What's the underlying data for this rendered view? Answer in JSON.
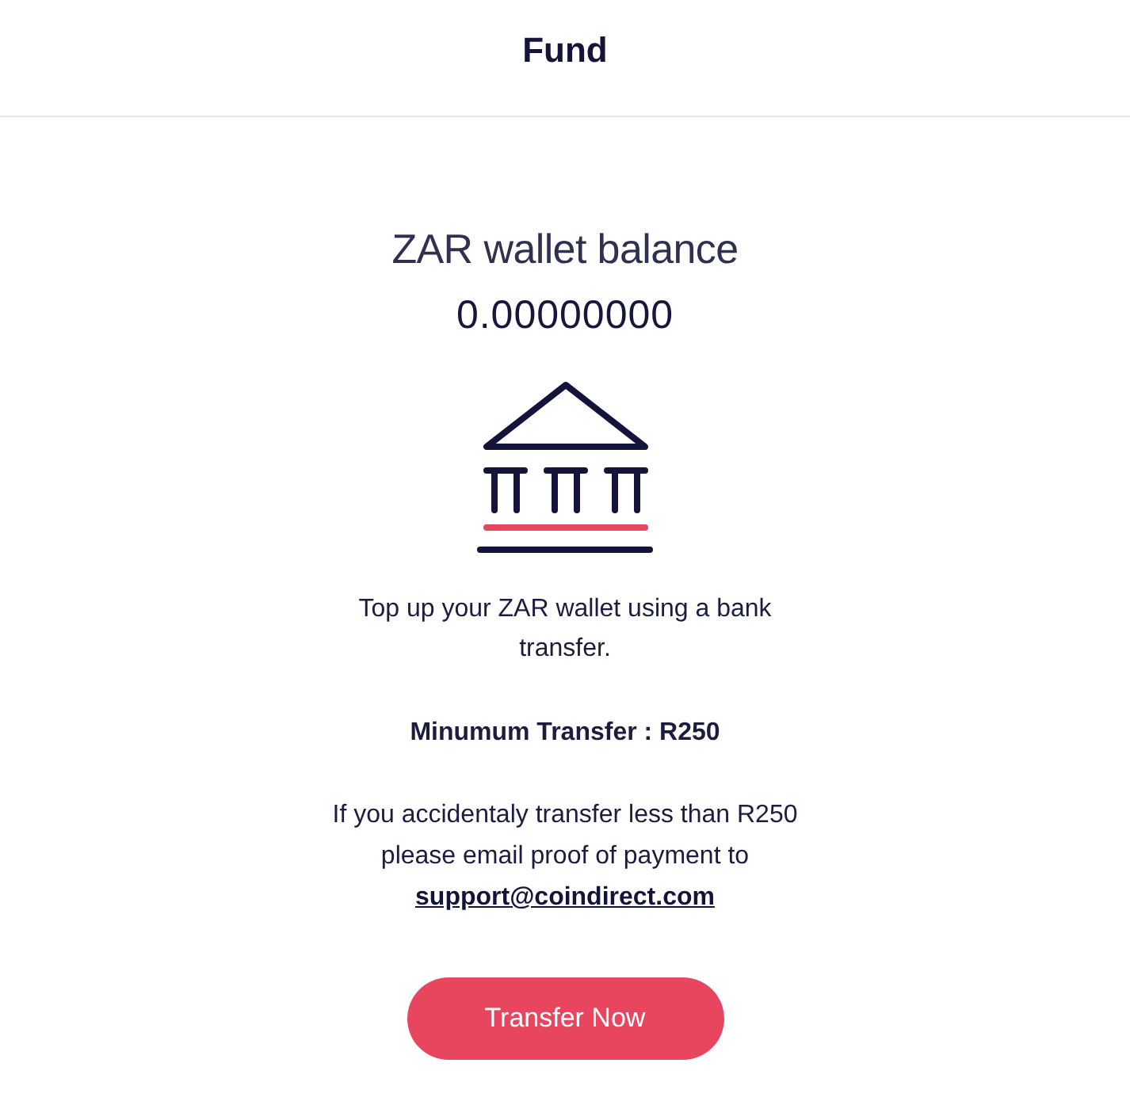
{
  "header": {
    "title": "Fund"
  },
  "balance": {
    "label": "ZAR wallet balance",
    "amount": "0.00000000"
  },
  "intro": "Top up your ZAR wallet using a bank transfer.",
  "minimum": "Minumum Transfer : R250",
  "notice": {
    "text": "If you accidentaly transfer less than R250 please email proof of payment to",
    "link": "support@coindirect.com"
  },
  "button": {
    "label": "Transfer Now"
  }
}
